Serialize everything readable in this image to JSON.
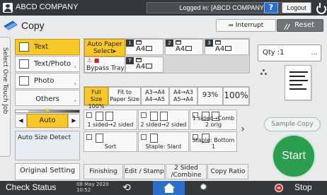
{
  "topbar": {
    "company": "ABCD COMPANY",
    "login_status": "Logged in: [ABCD COMPANY]",
    "help": "?",
    "logout": "Logout"
  },
  "header": {
    "title": "Copy",
    "interrupt": "Interrupt",
    "reset": "Reset"
  },
  "side_tab": {
    "label": "Select One Touch Job"
  },
  "original_type": [
    {
      "label": "Text",
      "selected": true
    },
    {
      "label": "Text/Photo",
      "selected": false
    },
    {
      "label": "Photo",
      "selected": false
    },
    {
      "label": "Others",
      "selected": false
    }
  ],
  "density": {
    "value": "Auto",
    "left": "◀",
    "right": "▶"
  },
  "auto_size_detect": "Auto Size Detect",
  "original_setting": "Original Setting",
  "paper": {
    "auto_line1": "Auto Paper",
    "auto_line2": "Select▸",
    "trays": [
      {
        "num": "1",
        "size": "A4"
      },
      {
        "num": "2",
        "size": "A4"
      },
      {
        "num": "3",
        "size": "A4"
      },
      {
        "num": "T",
        "size": "A4"
      }
    ],
    "bypass": "Bypass Tray"
  },
  "ratio": {
    "full_size_1": "Full Size",
    "full_size_2": "100%",
    "fit_1": "Fit to",
    "fit_2": "Paper Size",
    "a3a4_1": "A3→A4",
    "a3a4_2": "A4→A5",
    "a4a3_1": "A4→A3",
    "a4a3_2": "A5→A4",
    "pct93": "93%",
    "pct100": "100%"
  },
  "finishing": {
    "row1": [
      "1 sided→2 sided",
      "2 sided→2 sided",
      "1 sided→Comb 2 orig"
    ],
    "row2": [
      "Sort",
      "Staple: Slant",
      "Staple: Bottom 1"
    ],
    "next": "›"
  },
  "tabs": [
    "Finishing",
    "Edit / Stamp",
    "2 Sided /Combine",
    "Copy Ratio"
  ],
  "right": {
    "qty_label": "Qty :",
    "qty_value": "1",
    "qty_more": "...",
    "sample_copy": "Sample Copy",
    "start": "Start"
  },
  "bottombar": {
    "check_status": "Check Status",
    "date": "08 May 2020",
    "time": "10:52",
    "stop": "Stop"
  }
}
